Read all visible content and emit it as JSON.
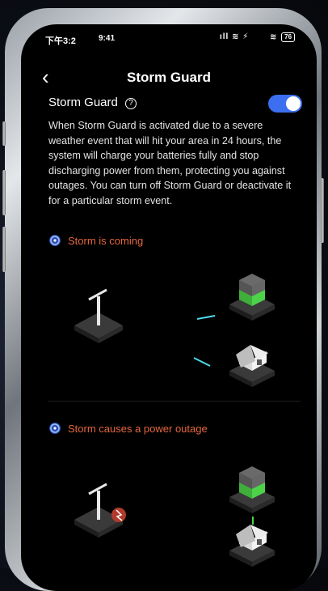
{
  "status_bar": {
    "carrier_time": "下午3:2",
    "clock": "9:41",
    "signal_icons": "ıll ≋ ⚡",
    "battery": "76"
  },
  "nav": {
    "title": "Storm Guard",
    "back_icon": "chevron-left-icon"
  },
  "storm_guard": {
    "label": "Storm Guard",
    "help_icon": "?",
    "toggle_on": true,
    "description": "When Storm Guard is activated due to a severe weather event that will hit your area in 24 hours, the system will charge your batteries fully and stop discharging power from them, protecting you against outages. You can turn off Storm Guard or deactivate it for a particular storm event."
  },
  "scenes": [
    {
      "label": "Storm is coming",
      "icon": "storm-icon"
    },
    {
      "label": "Storm causes a power outage",
      "icon": "storm-icon"
    }
  ],
  "colors": {
    "accent_blue": "#3c6ff0",
    "storm_orange": "#e5673f",
    "battery_green": "#4cd34a",
    "flow_cyan": "#4fd8e8",
    "outage_red": "#b13a2a"
  }
}
